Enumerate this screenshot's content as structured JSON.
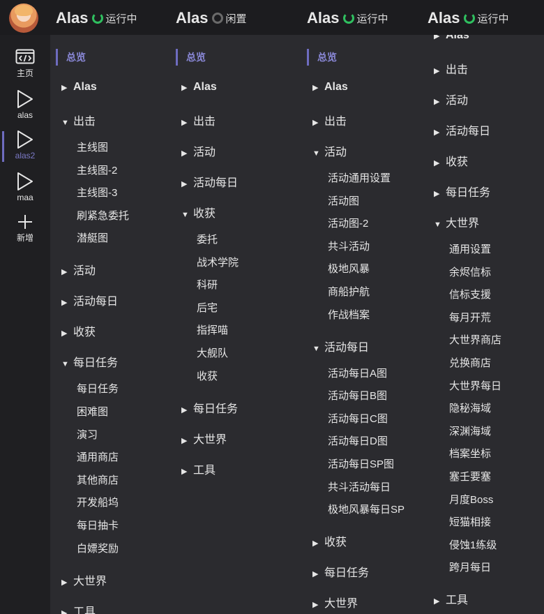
{
  "instances": [
    {
      "name": "Alas",
      "status": "运行中",
      "state": "running"
    },
    {
      "name": "Alas",
      "status": "闲置",
      "state": "idle"
    },
    {
      "name": "Alas",
      "status": "运行中",
      "state": "running"
    },
    {
      "name": "Alas",
      "status": "运行中",
      "state": "running"
    }
  ],
  "sidenav": {
    "home": "主页",
    "alas": "alas",
    "alas2": "alas2",
    "maa": "maa",
    "add": "新增"
  },
  "columns": [
    {
      "overview": "总览",
      "items": [
        {
          "type": "group",
          "arrow": "▶",
          "label": "Alas"
        },
        {
          "type": "group",
          "arrow": "▼",
          "label": "出击"
        },
        {
          "type": "sub",
          "label": "主线图"
        },
        {
          "type": "sub",
          "label": "主线图-2"
        },
        {
          "type": "sub",
          "label": "主线图-3"
        },
        {
          "type": "sub",
          "label": "刷紧急委托"
        },
        {
          "type": "sub",
          "label": "潜艇图"
        },
        {
          "type": "group",
          "arrow": "▶",
          "label": "活动"
        },
        {
          "type": "group",
          "arrow": "▶",
          "label": "活动每日"
        },
        {
          "type": "group",
          "arrow": "▶",
          "label": "收获"
        },
        {
          "type": "group",
          "arrow": "▼",
          "label": "每日任务"
        },
        {
          "type": "sub",
          "label": "每日任务"
        },
        {
          "type": "sub",
          "label": "困难图"
        },
        {
          "type": "sub",
          "label": "演习"
        },
        {
          "type": "sub",
          "label": "通用商店"
        },
        {
          "type": "sub",
          "label": "其他商店"
        },
        {
          "type": "sub",
          "label": "开发船坞"
        },
        {
          "type": "sub",
          "label": "每日抽卡"
        },
        {
          "type": "sub",
          "label": "白嫖奖励"
        },
        {
          "type": "group",
          "arrow": "▶",
          "label": "大世界"
        },
        {
          "type": "group",
          "arrow": "▶",
          "label": "工具"
        }
      ]
    },
    {
      "overview": "总览",
      "items": [
        {
          "type": "group",
          "arrow": "▶",
          "label": "Alas"
        },
        {
          "type": "group",
          "arrow": "▶",
          "label": "出击"
        },
        {
          "type": "group",
          "arrow": "▶",
          "label": "活动"
        },
        {
          "type": "group",
          "arrow": "▶",
          "label": "活动每日"
        },
        {
          "type": "group",
          "arrow": "▼",
          "label": "收获"
        },
        {
          "type": "sub",
          "label": "委托"
        },
        {
          "type": "sub",
          "label": "战术学院"
        },
        {
          "type": "sub",
          "label": "科研"
        },
        {
          "type": "sub",
          "label": "后宅"
        },
        {
          "type": "sub",
          "label": "指挥喵"
        },
        {
          "type": "sub",
          "label": "大舰队"
        },
        {
          "type": "sub",
          "label": "收获"
        },
        {
          "type": "group",
          "arrow": "▶",
          "label": "每日任务"
        },
        {
          "type": "group",
          "arrow": "▶",
          "label": "大世界"
        },
        {
          "type": "group",
          "arrow": "▶",
          "label": "工具"
        }
      ]
    },
    {
      "overview": "总览",
      "items": [
        {
          "type": "group",
          "arrow": "▶",
          "label": "Alas"
        },
        {
          "type": "group",
          "arrow": "▶",
          "label": "出击"
        },
        {
          "type": "group",
          "arrow": "▼",
          "label": "活动"
        },
        {
          "type": "sub",
          "label": "活动通用设置"
        },
        {
          "type": "sub",
          "label": "活动图"
        },
        {
          "type": "sub",
          "label": "活动图-2"
        },
        {
          "type": "sub",
          "label": "共斗活动"
        },
        {
          "type": "sub",
          "label": "极地风暴"
        },
        {
          "type": "sub",
          "label": "商船护航"
        },
        {
          "type": "sub",
          "label": "作战档案"
        },
        {
          "type": "group",
          "arrow": "▼",
          "label": "活动每日"
        },
        {
          "type": "sub",
          "label": "活动每日A图"
        },
        {
          "type": "sub",
          "label": "活动每日B图"
        },
        {
          "type": "sub",
          "label": "活动每日C图"
        },
        {
          "type": "sub",
          "label": "活动每日D图"
        },
        {
          "type": "sub",
          "label": "活动每日SP图"
        },
        {
          "type": "sub",
          "label": "共斗活动每日"
        },
        {
          "type": "sub",
          "label": "极地风暴每日SP"
        },
        {
          "type": "group",
          "arrow": "▶",
          "label": "收获"
        },
        {
          "type": "group",
          "arrow": "▶",
          "label": "每日任务"
        },
        {
          "type": "group",
          "arrow": "▶",
          "label": "大世界"
        }
      ]
    },
    {
      "items": [
        {
          "type": "group",
          "arrow": "▶",
          "label": "Alas"
        },
        {
          "type": "group",
          "arrow": "▶",
          "label": "出击"
        },
        {
          "type": "group",
          "arrow": "▶",
          "label": "活动"
        },
        {
          "type": "group",
          "arrow": "▶",
          "label": "活动每日"
        },
        {
          "type": "group",
          "arrow": "▶",
          "label": "收获"
        },
        {
          "type": "group",
          "arrow": "▶",
          "label": "每日任务"
        },
        {
          "type": "group",
          "arrow": "▼",
          "label": "大世界"
        },
        {
          "type": "sub",
          "label": "通用设置"
        },
        {
          "type": "sub",
          "label": "余烬信标"
        },
        {
          "type": "sub",
          "label": "信标支援"
        },
        {
          "type": "sub",
          "label": "每月开荒"
        },
        {
          "type": "sub",
          "label": "大世界商店"
        },
        {
          "type": "sub",
          "label": "兑换商店"
        },
        {
          "type": "sub",
          "label": "大世界每日"
        },
        {
          "type": "sub",
          "label": "隐秘海域"
        },
        {
          "type": "sub",
          "label": "深渊海域"
        },
        {
          "type": "sub",
          "label": "档案坐标"
        },
        {
          "type": "sub",
          "label": "塞壬要塞"
        },
        {
          "type": "sub",
          "label": "月度Boss"
        },
        {
          "type": "sub",
          "label": "短猫相接"
        },
        {
          "type": "sub",
          "label": "侵蚀1练级"
        },
        {
          "type": "sub",
          "label": "跨月每日"
        },
        {
          "type": "group",
          "arrow": "▶",
          "label": "工具"
        }
      ]
    }
  ]
}
